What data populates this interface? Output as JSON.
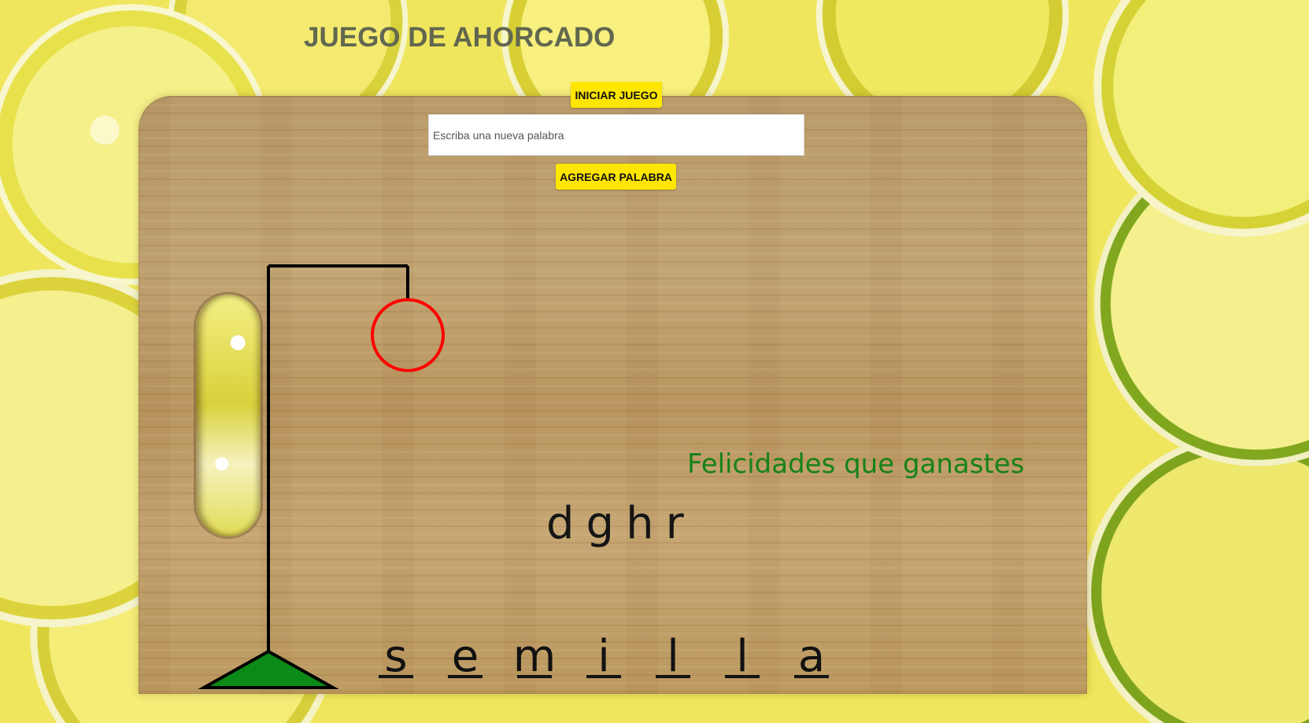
{
  "header": {
    "title": "JUEGO DE AHORCADO"
  },
  "controls": {
    "start_label": "INICIAR JUEGO",
    "new_word_placeholder": "Escriba una nueva palabra",
    "add_word_label": "AGREGAR PALABRA"
  },
  "game": {
    "status_message": "Felicidades que ganastes",
    "wrong_letters": [
      "d",
      "g",
      "h",
      "r"
    ],
    "word_letters": [
      "s",
      "e",
      "m",
      "i",
      "l",
      "l",
      "a"
    ]
  },
  "colors": {
    "button": "#ffe600",
    "message": "#168219",
    "head": "#ff0000",
    "base": "#0b8a18",
    "gallows": "#000000"
  },
  "icons": {
    "background": "lemon-slices-background",
    "board": "bamboo-cutting-board"
  }
}
